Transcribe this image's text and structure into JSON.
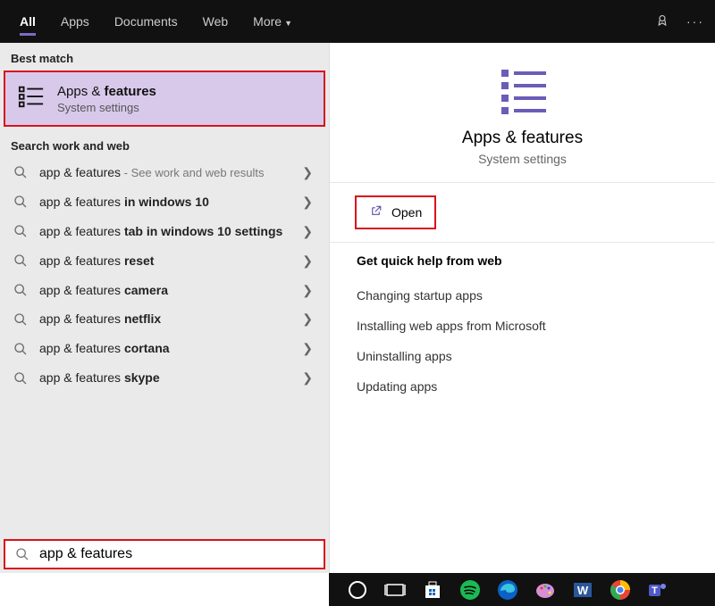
{
  "tabs": {
    "all": "All",
    "apps": "Apps",
    "documents": "Documents",
    "web": "Web",
    "more": "More"
  },
  "sections": {
    "best_match": "Best match",
    "search_web": "Search work and web",
    "quick_help": "Get quick help from web"
  },
  "best_match": {
    "title_prefix": "Apps & ",
    "title_bold": "features",
    "subtitle": "System settings"
  },
  "results": [
    {
      "base": "app & features",
      "suffix": "",
      "hint": " - See work and web results"
    },
    {
      "base": "app & features ",
      "suffix": "in windows 10",
      "hint": ""
    },
    {
      "base": "app & features ",
      "suffix": "tab in windows 10 settings",
      "hint": ""
    },
    {
      "base": "app & features ",
      "suffix": "reset",
      "hint": ""
    },
    {
      "base": "app & features ",
      "suffix": "camera",
      "hint": ""
    },
    {
      "base": "app & features ",
      "suffix": "netflix",
      "hint": ""
    },
    {
      "base": "app & features ",
      "suffix": "cortana",
      "hint": ""
    },
    {
      "base": "app & features ",
      "suffix": "skype",
      "hint": ""
    }
  ],
  "preview": {
    "title": "Apps & features",
    "subtitle": "System settings",
    "open": "Open"
  },
  "quick_links": [
    "Changing startup apps",
    "Installing web apps from Microsoft",
    "Uninstalling apps",
    "Updating apps"
  ],
  "search": {
    "value": "app & features"
  }
}
